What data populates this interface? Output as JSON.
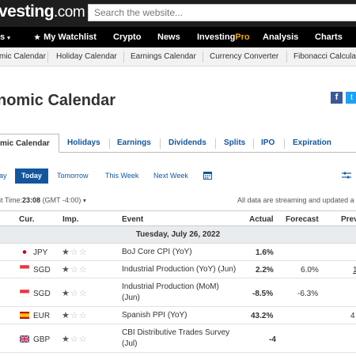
{
  "header": {
    "logo_text": "vesting",
    "logo_suffix": ".com",
    "search_placeholder": "Search the website..."
  },
  "main_nav": {
    "items": [
      "s",
      "My Watchlist",
      "Crypto",
      "News",
      "Investing",
      "Pro",
      "Analysis",
      "Charts"
    ]
  },
  "sub_nav": {
    "items": [
      "mic Calendar",
      "Holiday Calendar",
      "Earnings Calendar",
      "Currency Converter",
      "Fibonacci Calcula"
    ]
  },
  "page": {
    "title": "nomic Calendar",
    "share_fb": "f",
    "share_tw": "t"
  },
  "tabs": [
    "mic Calendar",
    "Holidays",
    "Earnings",
    "Dividends",
    "Splits",
    "IPO",
    "Expiration"
  ],
  "date_filter": {
    "items": [
      "ay",
      "Today",
      "Tomorrow",
      "This Week",
      "Next Week"
    ],
    "active": "Today"
  },
  "time_info": {
    "prefix": "nt Time:",
    "time": "23:08",
    "zone": "(GMT -4:00)",
    "streaming_note": "All data are streaming and updated a"
  },
  "table": {
    "headers": [
      "Cur.",
      "Imp.",
      "Event",
      "Actual",
      "Forecast",
      "Prev"
    ],
    "day_label": "Tuesday, July 26, 2022",
    "rows": [
      {
        "currency": "JPY",
        "importance": 1,
        "event_line1": "BoJ Core CPI (YoY)",
        "event_line2": "",
        "actual": "1.6%",
        "actual_color": "#333333",
        "forecast": "",
        "previous": ""
      },
      {
        "currency": "SGD",
        "importance": 1,
        "event_line1": "Industrial Production (YoY) (Jun)",
        "event_line2": "",
        "actual": "2.2%",
        "actual_color": "#e31d1d",
        "forecast": "6.0%",
        "previous": "1"
      },
      {
        "currency": "SGD",
        "importance": 1,
        "event_line1": "Industrial Production (MoM)",
        "event_line2": "(Jun)",
        "actual": "-8.5%",
        "actual_color": "#e31d1d",
        "forecast": "-6.3%",
        "previous": ""
      },
      {
        "currency": "EUR",
        "importance": 1,
        "event_line1": "Spanish PPI (YoY)",
        "event_line2": "",
        "actual": "43.2%",
        "actual_color": "#333333",
        "forecast": "",
        "previous": "4"
      },
      {
        "currency": "GBP",
        "importance": 1,
        "event_line1": "CBI Distributive Trades Survey",
        "event_line2": "(Jul)",
        "actual": "-4",
        "actual_color": "#333333",
        "forecast": "",
        "previous": ""
      }
    ]
  }
}
